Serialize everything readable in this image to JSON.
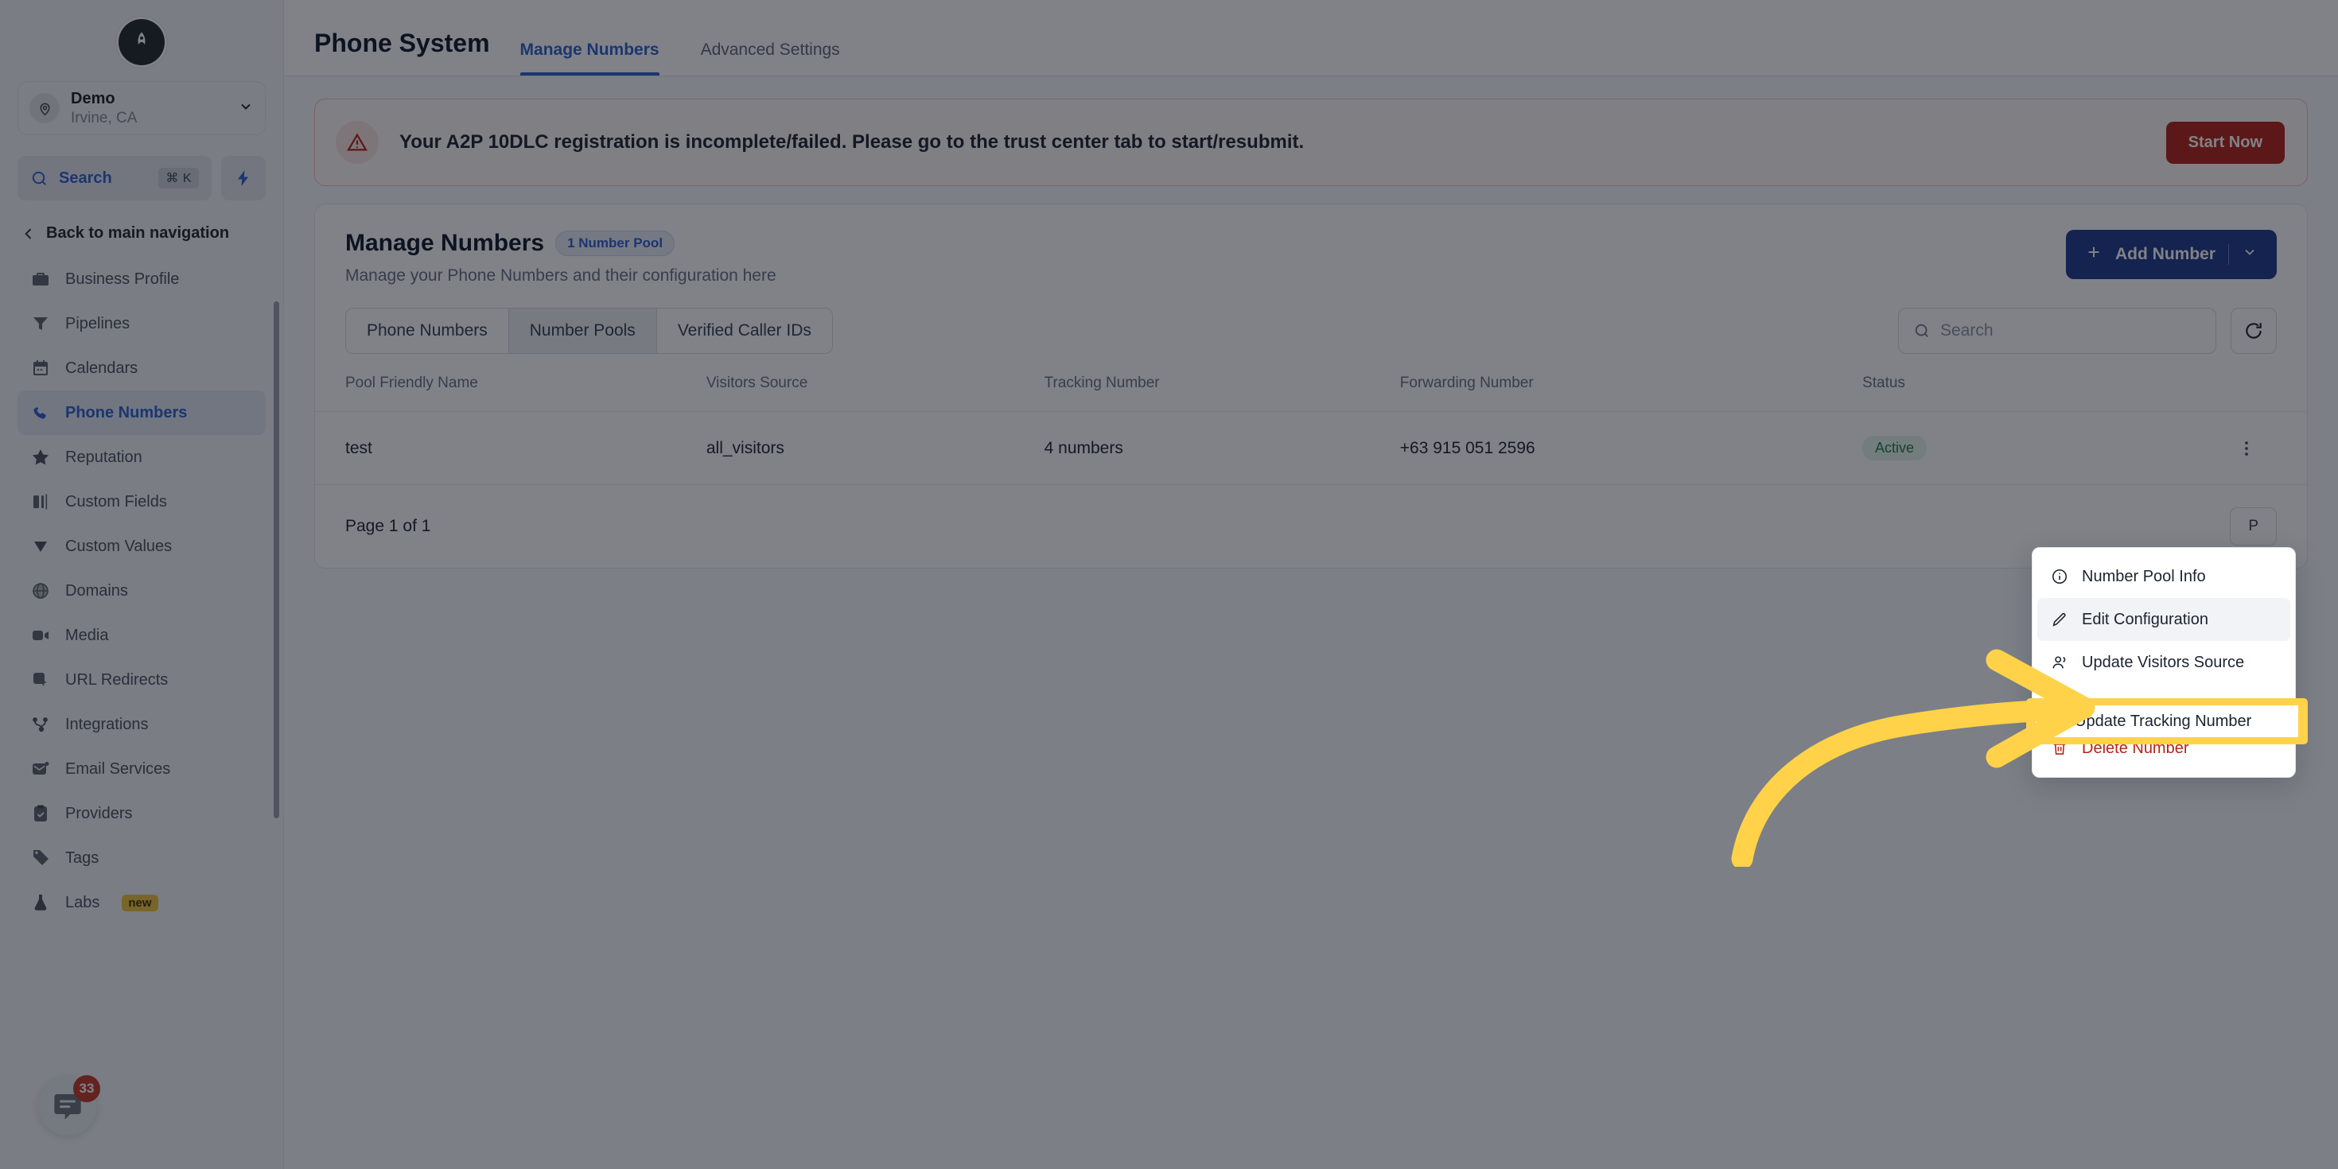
{
  "sidebar": {
    "logo_icon": "rocket-logo-icon",
    "account": {
      "name": "Demo",
      "location": "Irvine, CA",
      "avatar_icon": "location-pin-icon",
      "chevron_icon": "chevron-down-icon"
    },
    "search": {
      "label": "Search",
      "shortcut": "⌘ K",
      "icon": "search-icon"
    },
    "quick_action_icon": "lightning-bolt-icon",
    "back_nav": {
      "label": "Back to main navigation",
      "icon": "chevron-left-icon"
    },
    "items": [
      {
        "label": "Business Profile",
        "icon": "briefcase-icon",
        "active": false
      },
      {
        "label": "Pipelines",
        "icon": "funnel-icon",
        "active": false
      },
      {
        "label": "Calendars",
        "icon": "calendar-icon",
        "active": false
      },
      {
        "label": "Phone Numbers",
        "icon": "phone-icon",
        "active": true
      },
      {
        "label": "Reputation",
        "icon": "star-icon",
        "active": false
      },
      {
        "label": "Custom Fields",
        "icon": "fields-icon",
        "active": false
      },
      {
        "label": "Custom Values",
        "icon": "gem-icon",
        "active": false
      },
      {
        "label": "Domains",
        "icon": "globe-icon",
        "active": false
      },
      {
        "label": "Media",
        "icon": "video-icon",
        "active": false
      },
      {
        "label": "URL Redirects",
        "icon": "cursor-box-icon",
        "active": false
      },
      {
        "label": "Integrations",
        "icon": "nodes-icon",
        "active": false
      },
      {
        "label": "Email Services",
        "icon": "envelope-icon",
        "active": false
      },
      {
        "label": "Providers",
        "icon": "clipboard-check-icon",
        "active": false
      },
      {
        "label": "Tags",
        "icon": "tag-icon",
        "active": false
      },
      {
        "label": "Labs",
        "icon": "flask-icon",
        "active": false,
        "badge": "new"
      }
    ],
    "chat": {
      "icon": "chat-bubble-icon",
      "unread_count": "33"
    }
  },
  "topbar": {
    "title": "Phone System",
    "tabs": [
      {
        "label": "Manage Numbers",
        "active": true
      },
      {
        "label": "Advanced Settings",
        "active": false
      }
    ]
  },
  "alert": {
    "icon": "warning-triangle-icon",
    "message": "Your A2P 10DLC registration is incomplete/failed. Please go to the trust center tab to start/resubmit.",
    "action_label": "Start Now"
  },
  "panel": {
    "title": "Manage Numbers",
    "pill": "1 Number Pool",
    "subtitle": "Manage your Phone Numbers and their configuration here",
    "add_button": {
      "label": "Add Number",
      "plus_icon": "plus-icon",
      "chevron_icon": "chevron-down-icon"
    },
    "segmented": [
      {
        "label": "Phone Numbers",
        "active": false
      },
      {
        "label": "Number Pools",
        "active": true
      },
      {
        "label": "Verified Caller IDs",
        "active": false
      }
    ],
    "search": {
      "placeholder": "Search",
      "icon": "search-icon"
    },
    "refresh_icon": "refresh-icon"
  },
  "table": {
    "columns": [
      "Pool Friendly Name",
      "Visitors Source",
      "Tracking Number",
      "Forwarding Number",
      "Status",
      ""
    ],
    "rows": [
      {
        "pool_friendly_name": "test",
        "visitors_source": "all_visitors",
        "tracking_number": "4 numbers",
        "forwarding_number": "+63 915 051 2596",
        "status": "Active",
        "menu_icon": "kebab-menu-icon"
      }
    ]
  },
  "pagination": {
    "page_text": "Page 1 of 1",
    "prev_label": "P",
    "next_label": ""
  },
  "dropdown": {
    "items": [
      {
        "label": "Number Pool Info",
        "icon": "info-circle-icon",
        "state": "normal"
      },
      {
        "label": "Edit Configuration",
        "icon": "pencil-icon",
        "state": "hovered"
      },
      {
        "label": "Update Visitors Source",
        "icon": "users-icon",
        "state": "normal"
      },
      {
        "label": "Update Tracking Number",
        "icon": "broadcast-icon",
        "state": "highlighted"
      },
      {
        "label": "Delete Number",
        "icon": "trash-icon",
        "state": "danger"
      }
    ]
  },
  "annotation": {
    "arrow_icon": "curved-arrow-right-icon",
    "color": "#ffd24a",
    "highlight_color": "#ffd24a"
  },
  "colors": {
    "accent": "#2f5fd0",
    "primary_button": "#1e3a8a",
    "danger": "#b42318",
    "success": "#1f7a46",
    "highlight": "#ffd24a",
    "scrim": "rgba(11,16,24,0.52)"
  }
}
